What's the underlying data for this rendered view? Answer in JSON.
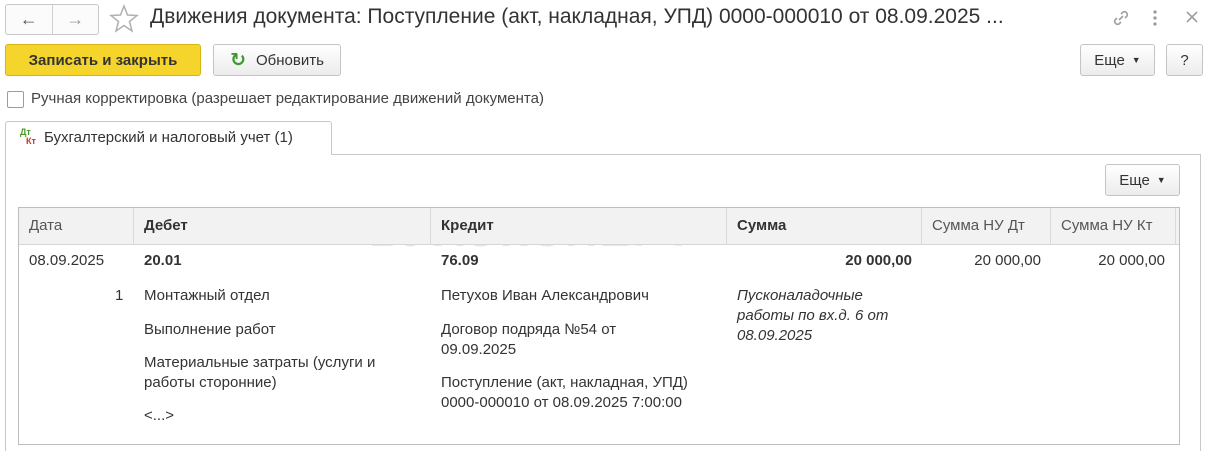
{
  "header": {
    "title": "Движения документа: Поступление (акт, накладная, УПД) 0000-000010 от 08.09.2025 ...",
    "back_icon": "arrow-left-icon",
    "forward_icon": "arrow-right-icon",
    "favorite_icon": "star-icon",
    "link_icon": "link-icon",
    "menu_icon": "more-vertical-icon",
    "close_icon": "close-icon"
  },
  "toolbar": {
    "save_close_label": "Записать и закрыть",
    "refresh_label": "Обновить",
    "more_label": "Еще",
    "help_label": "?"
  },
  "manual_correction": {
    "label": "Ручная корректировка (разрешает редактирование движений документа)",
    "checked": false
  },
  "tabs": [
    {
      "label": "Бухгалтерский и налоговый учет (1)",
      "icon_dt": "Дт",
      "icon_kt": "Кт"
    }
  ],
  "panel": {
    "more_label": "Еще"
  },
  "watermark": "БУХЭКСПЕРТ",
  "table": {
    "columns": [
      "Дата",
      "Дебет",
      "Кредит",
      "Сумма",
      "Сумма НУ Дт",
      "Сумма НУ Кт"
    ],
    "row": {
      "date": "08.09.2025",
      "line_no": "1",
      "debit_account": "20.01",
      "debit_subconto1": "Монтажный отдел",
      "debit_subconto2": "Выполнение работ",
      "debit_subconto3": "Материальные затраты (услуги и работы сторонние)",
      "debit_more": "<...>",
      "credit_account": "76.09",
      "credit_subconto1": "Петухов Иван Александрович",
      "credit_subconto2": "Договор подряда №54 от 09.09.2025",
      "credit_subconto3": "Поступление (акт, накладная, УПД) 0000-000010 от 08.09.2025 7:00:00",
      "sum": "20 000,00",
      "content": "Пусконаладочные работы по вх.д. 6 от 08.09.2025",
      "sum_nu_dt": "20 000,00",
      "sum_nu_kt": "20 000,00"
    }
  },
  "colors": {
    "primary_button": "#f5d42b",
    "refresh_icon": "#3e9a2e"
  }
}
